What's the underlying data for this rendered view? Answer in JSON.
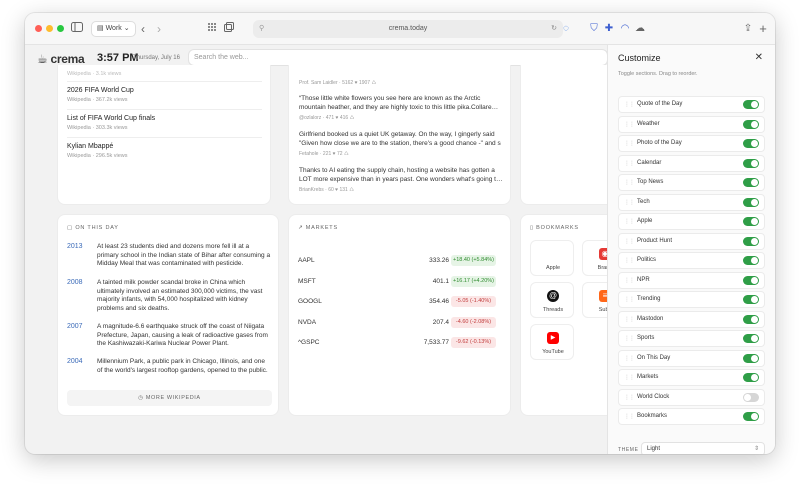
{
  "browser": {
    "profile_label": "Work",
    "url": "crema.today"
  },
  "header": {
    "logo": "crema",
    "time": "3:57 PM",
    "date": "Thursday, July 16",
    "search_placeholder": "Search the web..."
  },
  "wikipedia": {
    "items": [
      {
        "title": "2026 FIFA World Cup",
        "source": "Wikipedia",
        "views": "367.2k views"
      },
      {
        "title": "List of FIFA World Cup finals",
        "source": "Wikipedia",
        "views": "303.3k views"
      },
      {
        "title": "Kylian Mbappé",
        "source": "Wikipedia",
        "views": "296.5k views"
      }
    ]
  },
  "social": {
    "posts": [
      {
        "text": "“Those little white flowers you see here are known as the Arctic mountain heather, and they are highly toxic to this little pika.Collare…",
        "author": "@ozlalorz",
        "stats": "471 ♥ 416 ♺"
      },
      {
        "text": "Girlfriend booked us a quiet UK getaway. On the way, I gingerly said \"Given how close we are to the station, there's a good chance -\" and s",
        "author": "Fetahole",
        "stats": "221 ♥ 72 ♺"
      },
      {
        "text": "Thanks to AI eating the supply chain, hosting a website has gotten a LOT more expensive than in years past. One wonders what's going t…",
        "author": "BrianKrebs",
        "stats": "60 ♥ 131 ♺"
      }
    ]
  },
  "on_this_day": {
    "title": "On This Day",
    "events": [
      {
        "year": "2013",
        "text": "At least 23 students died and dozens more fell ill at a primary school in the Indian state of Bihar after consuming a Midday Meal that was contaminated with pesticide."
      },
      {
        "year": "2008",
        "text": "A tainted milk powder scandal broke in China which ultimately involved an estimated 300,000 victims, the vast majority infants, with 54,000 hospitalized with kidney problems and six deaths."
      },
      {
        "year": "2007",
        "text": "A magnitude-6.6 earthquake struck off the coast of Niigata Prefecture, Japan, causing a leak of radioactive gases from the Kashiwazaki-Kariwa Nuclear Power Plant."
      },
      {
        "year": "2004",
        "text": "Millennium Park, a public park in Chicago, Illinois, and one of the world's largest rooftop gardens, opened to the public."
      }
    ],
    "more_label": "More Wikipedia"
  },
  "markets": {
    "title": "Markets",
    "rows": [
      {
        "symbol": "AAPL",
        "price": "333.26",
        "change": "+18.40 (+5.84%)",
        "dir": "up"
      },
      {
        "symbol": "MSFT",
        "price": "401.1",
        "change": "+16.17 (+4.20%)",
        "dir": "up"
      },
      {
        "symbol": "GOOGL",
        "price": "354.46",
        "change": "-5.05 (-1.40%)",
        "dir": "down"
      },
      {
        "symbol": "NVDA",
        "price": "207.4",
        "change": "-4.60 (-2.08%)",
        "dir": "down"
      },
      {
        "symbol": "^GSPC",
        "price": "7,533.77",
        "change": "-9.62 (-0.13%)",
        "dir": "down"
      }
    ]
  },
  "bookmarks": {
    "title": "Bookmarks",
    "items": [
      {
        "label": "Apple",
        "icon": "apple-icon",
        "color": "#ffffff"
      },
      {
        "label": "Brand",
        "icon": "brand-icon",
        "color": "#e53935"
      },
      {
        "label": "Threads",
        "icon": "threads-icon",
        "color": "#111111"
      },
      {
        "label": "Subs",
        "icon": "substack-icon",
        "color": "#ff6719"
      },
      {
        "label": "YouTube",
        "icon": "youtube-icon",
        "color": "#ff0000"
      }
    ]
  },
  "customize": {
    "title": "Customize",
    "subtitle": "Toggle sections. Drag to reorder.",
    "sections": [
      {
        "label": "Quote of the Day",
        "on": true
      },
      {
        "label": "Weather",
        "on": true
      },
      {
        "label": "Photo of the Day",
        "on": true
      },
      {
        "label": "Calendar",
        "on": true
      },
      {
        "label": "Top News",
        "on": true
      },
      {
        "label": "Tech",
        "on": true
      },
      {
        "label": "Apple",
        "on": true
      },
      {
        "label": "Product Hunt",
        "on": true
      },
      {
        "label": "Politics",
        "on": true
      },
      {
        "label": "NPR",
        "on": true
      },
      {
        "label": "Trending",
        "on": true
      },
      {
        "label": "Mastodon",
        "on": true
      },
      {
        "label": "Sports",
        "on": true
      },
      {
        "label": "On This Day",
        "on": true
      },
      {
        "label": "Markets",
        "on": true
      },
      {
        "label": "World Clock",
        "on": false
      },
      {
        "label": "Bookmarks",
        "on": true
      }
    ],
    "theme_label": "Theme",
    "theme_value": "Light"
  },
  "colors": {
    "toggle_on": "#2f9e47",
    "toggle_off": "#d6d6d6",
    "positive": "#2e8b2e",
    "negative": "#c23b3b",
    "year_link": "#3a6ab8"
  }
}
